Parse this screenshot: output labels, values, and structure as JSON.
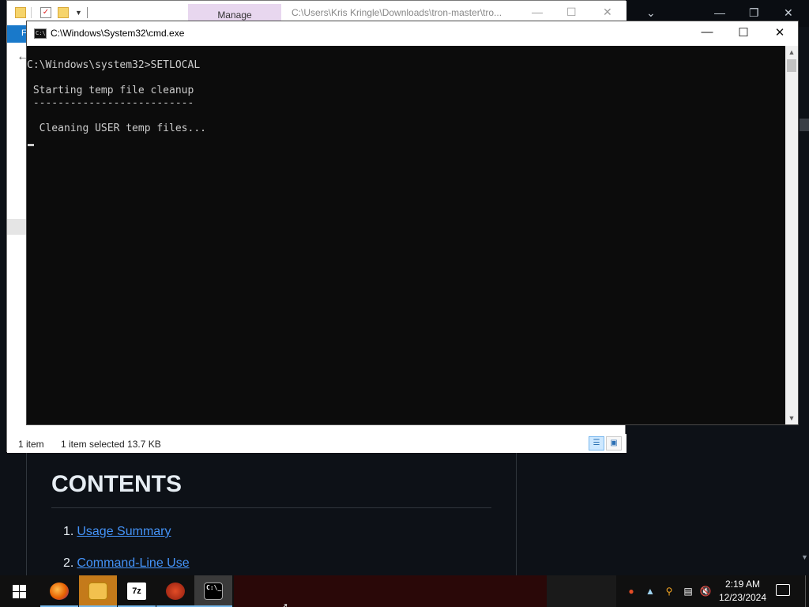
{
  "browser": {
    "contents_title": "CONTENTS",
    "toc": [
      {
        "num": "1.",
        "label": "Usage Summary"
      },
      {
        "num": "2.",
        "label": "Command-Line Use"
      }
    ]
  },
  "explorer": {
    "manage_tab": "Manage",
    "path": "C:\\Users\\Kris Kringle\\Downloads\\tron-master\\tro...",
    "ribbon_file": "F",
    "status_count": "1 item",
    "status_selected": "1 item selected  13.7 KB"
  },
  "cmd": {
    "title": "C:\\Windows\\System32\\cmd.exe",
    "lines": [
      "C:\\Windows\\system32>SETLOCAL",
      " Starting temp file cleanup",
      " --------------------------",
      "  Cleaning USER temp files..."
    ],
    "icon_text": "C:\\"
  },
  "taskbar": {
    "apps": [
      {
        "name": "Firefox",
        "glyph": "fox"
      },
      {
        "name": "File Explorer",
        "glyph": "folder"
      },
      {
        "name": "7-Zip",
        "glyph": "7z"
      },
      {
        "name": "CCleaner",
        "glyph": "C"
      },
      {
        "name": "Command Prompt",
        "glyph": "C:\\"
      }
    ],
    "time": "2:19 AM",
    "date": "12/23/2024"
  },
  "colors": {
    "cmd_bg": "#0c0c0c",
    "cmd_text": "#cccccc",
    "link": "#4493f8",
    "taskbar": "#101010",
    "accent": "#76b9ed"
  }
}
